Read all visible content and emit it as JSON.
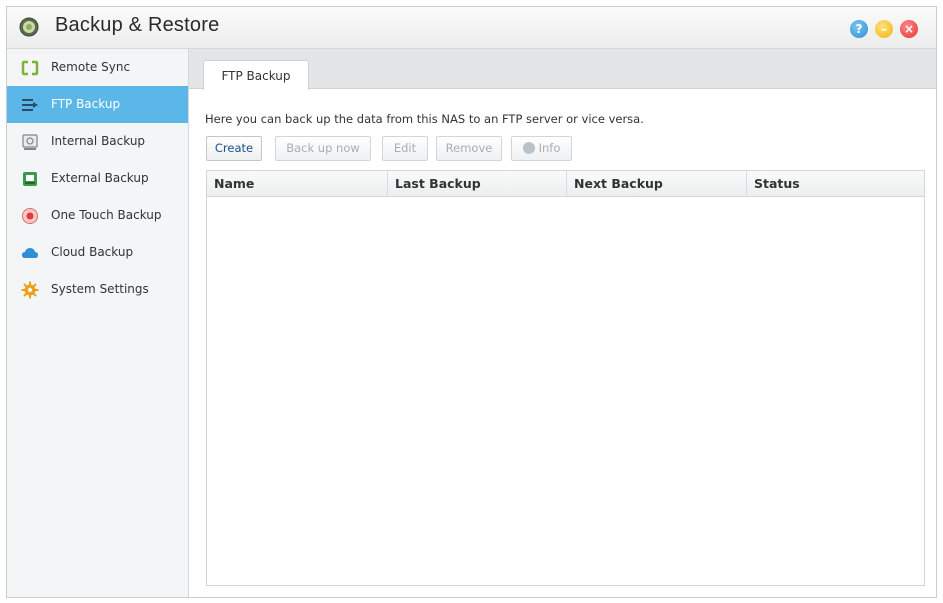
{
  "window": {
    "title": "Backup & Restore",
    "controls": {
      "help": "?",
      "minimize": "–",
      "close": "×"
    }
  },
  "sidebar": {
    "items": [
      {
        "label": "Remote Sync",
        "icon": "remote-sync-icon",
        "active": false
      },
      {
        "label": "FTP Backup",
        "icon": "ftp-backup-icon",
        "active": true
      },
      {
        "label": "Internal Backup",
        "icon": "internal-backup-icon",
        "active": false
      },
      {
        "label": "External Backup",
        "icon": "external-backup-icon",
        "active": false
      },
      {
        "label": "One Touch Backup",
        "icon": "one-touch-backup-icon",
        "active": false
      },
      {
        "label": "Cloud Backup",
        "icon": "cloud-icon",
        "active": false
      },
      {
        "label": "System Settings",
        "icon": "gear-icon",
        "active": false
      }
    ]
  },
  "main": {
    "tab": "FTP Backup",
    "description": "Here you can back up the data from this NAS to an FTP server or vice versa.",
    "toolbar": {
      "create": "Create",
      "back_up_now": "Back up now",
      "edit": "Edit",
      "remove": "Remove",
      "info": "Info"
    },
    "table": {
      "columns": [
        "Name",
        "Last Backup",
        "Next Backup",
        "Status"
      ],
      "rows": []
    }
  },
  "colors": {
    "accent": "#5ab7e8",
    "link_text": "#1a4f86"
  }
}
